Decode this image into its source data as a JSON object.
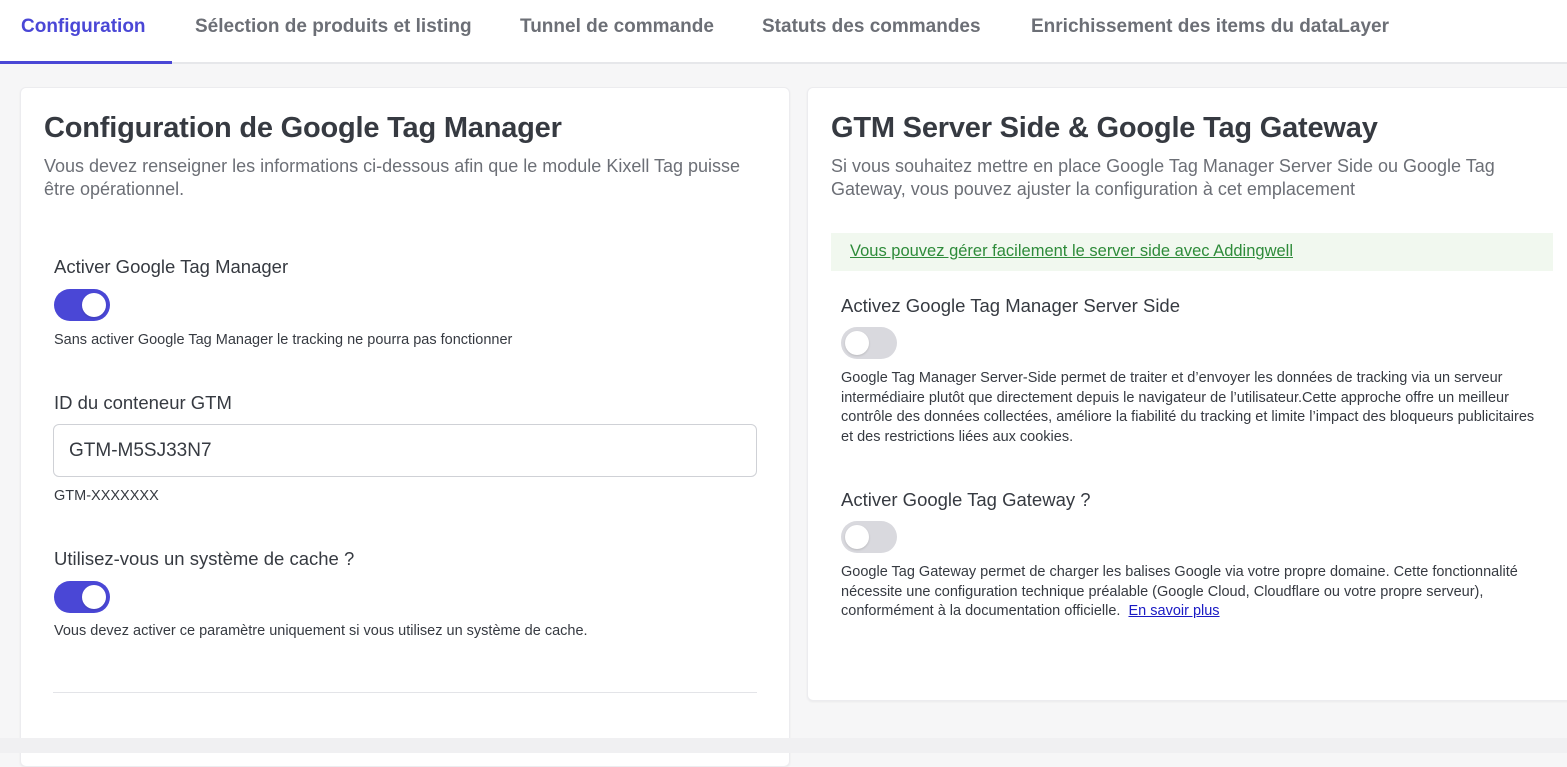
{
  "tabs": [
    {
      "label": "Configuration",
      "active": true
    },
    {
      "label": "Sélection de produits et listing",
      "active": false
    },
    {
      "label": "Tunnel de commande",
      "active": false
    },
    {
      "label": "Statuts des commandes",
      "active": false
    },
    {
      "label": "Enrichissement des items du dataLayer",
      "active": false
    }
  ],
  "left": {
    "title": "Configuration de Google Tag Manager",
    "lead": "Vous devez renseigner les informations ci-dessous afin que le module Kixell Tag puisse être opérationnel.",
    "enable_gtm": {
      "label": "Activer Google Tag Manager",
      "enabled": true,
      "help": "Sans activer Google Tag Manager le tracking ne pourra pas fonctionner"
    },
    "container_id": {
      "label": "ID du conteneur GTM",
      "value": "GTM-M5SJ33N7",
      "help": "GTM-XXXXXXX"
    },
    "cache": {
      "label": "Utilisez-vous un système de cache ?",
      "enabled": true,
      "help": "Vous devez activer ce paramètre uniquement si vous utilisez un système de cache."
    }
  },
  "right": {
    "title": "GTM Server Side & Google Tag Gateway",
    "lead": "Si vous souhaitez mettre en place Google Tag Manager Server Side ou Google Tag Gateway, vous pouvez ajuster la configuration à cet emplacement",
    "alert_link": "Vous pouvez gérer facilement le server side avec Addingwell",
    "server_side": {
      "label": "Activez Google Tag Manager Server Side",
      "enabled": false,
      "help": "Google Tag Manager Server-Side permet de traiter et d’envoyer les données de tracking via un serveur intermédiaire plutôt que directement depuis le navigateur de l’utilisateur.Cette approche offre un meilleur contrôle des données collectées, améliore la fiabilité du tracking et limite l’impact des bloqueurs publicitaires et des restrictions liées aux cookies."
    },
    "gateway": {
      "label": "Activer Google Tag Gateway ?",
      "enabled": false,
      "help": "Google Tag Gateway permet de charger les balises Google via votre propre domaine. Cette fonctionnalité nécessite une configuration technique préalable (Google Cloud, Cloudflare ou votre propre serveur), conformément à la documentation officielle.",
      "more_link": "En savoir plus"
    }
  },
  "colors": {
    "accent": "#4a47d6",
    "toggle_off": "#d9d9de",
    "success_text": "#2e8b3a",
    "success_bg": "#f1f8ef",
    "link": "#1a1ac4"
  }
}
